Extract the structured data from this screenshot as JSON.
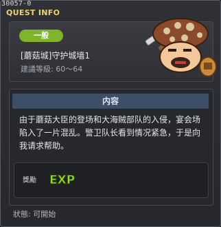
{
  "window": {
    "quest_id": "30057-0",
    "title": "QUEST INFO"
  },
  "quest": {
    "category": "一般",
    "name": "[蘑菇城]守护城墙1",
    "level": "建議等級: 60～64"
  },
  "content": {
    "header": "内容",
    "description": "由于蘑菇大臣的登场和大海贼部队的入侵，宴会场陷入了一片混乱。警卫队长看到情况紧急，于是向我请求帮助。"
  },
  "reward": {
    "label": "獎勵",
    "exp_text": "EXP"
  },
  "status": "狀態: 可開始",
  "colors": {
    "badge": "#7fb52a",
    "title": "#f2d36a",
    "content_header": "#3d4f66"
  }
}
